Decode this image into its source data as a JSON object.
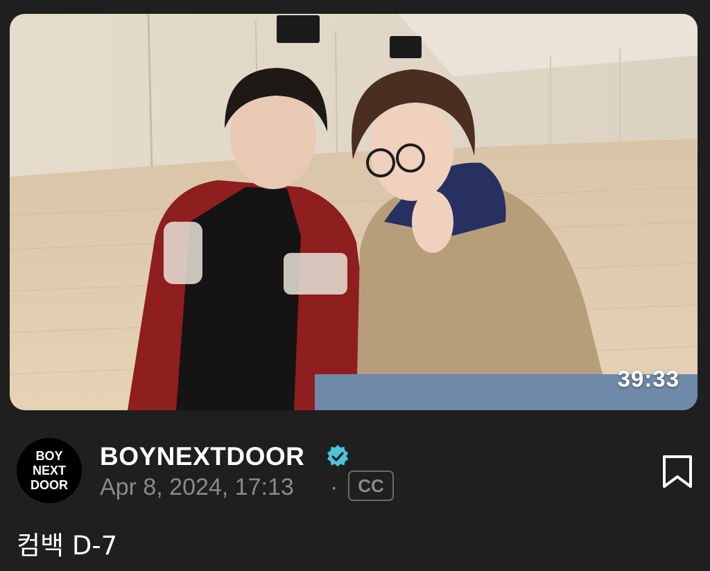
{
  "video": {
    "duration": "39:33",
    "thumbnail_description": "photo-thumbnail"
  },
  "channel": {
    "name": "BOYNEXTDOOR",
    "verified_icon": "verified-badge-icon",
    "avatar_text": [
      "BOY",
      "NEXT",
      "DOOR"
    ]
  },
  "post": {
    "date": "Apr 8, 2024, 17:13",
    "separator": "·",
    "cc_label": "CC",
    "caption": "컴백 D-7"
  },
  "actions": {
    "bookmark_icon": "bookmark-icon"
  },
  "colors": {
    "background": "#1f1f1f",
    "verified": "#4fc3d9",
    "muted_text": "#8a8a8a"
  }
}
